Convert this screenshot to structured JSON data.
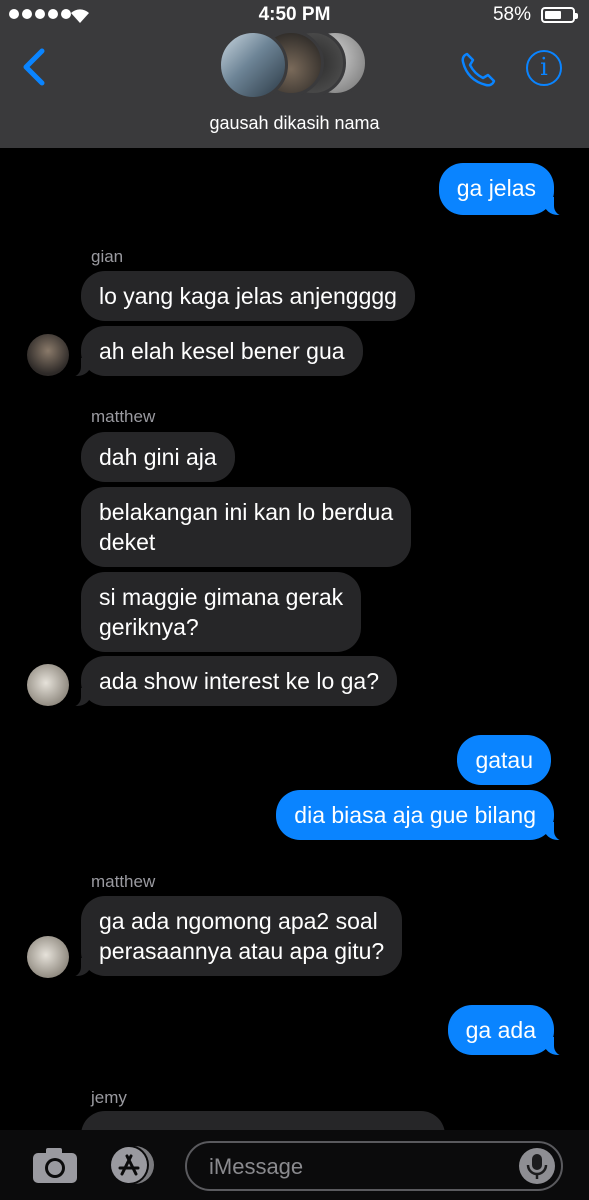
{
  "status": {
    "time": "4:50 PM",
    "battery": "58%"
  },
  "header": {
    "group_name": "gausah dikasih nama"
  },
  "messages": [
    {
      "text": "ga jelas"
    },
    {
      "sender": "gian"
    },
    {
      "text": "lo yang kaga jelas anjengggg"
    },
    {
      "text": "ah elah kesel bener gua"
    },
    {
      "sender": "matthew"
    },
    {
      "text": "dah gini aja"
    },
    {
      "line1": "belakangan ini kan lo berdua",
      "line2": "deket"
    },
    {
      "line1": "si maggie gimana gerak",
      "line2": "geriknya?"
    },
    {
      "text": "ada show interest ke lo ga?"
    },
    {
      "text": "gatau"
    },
    {
      "text": "dia biasa aja gue bilang"
    },
    {
      "sender": "matthew"
    },
    {
      "line1": "ga ada ngomong apa2 soal",
      "line2": "perasaannya atau apa gitu?"
    },
    {
      "text": "ga ada"
    },
    {
      "sender": "jemy"
    }
  ],
  "input": {
    "placeholder": "iMessage"
  },
  "colors": {
    "accent": "#0a84ff",
    "incoming": "#262628",
    "header": "#3a3a3c"
  }
}
